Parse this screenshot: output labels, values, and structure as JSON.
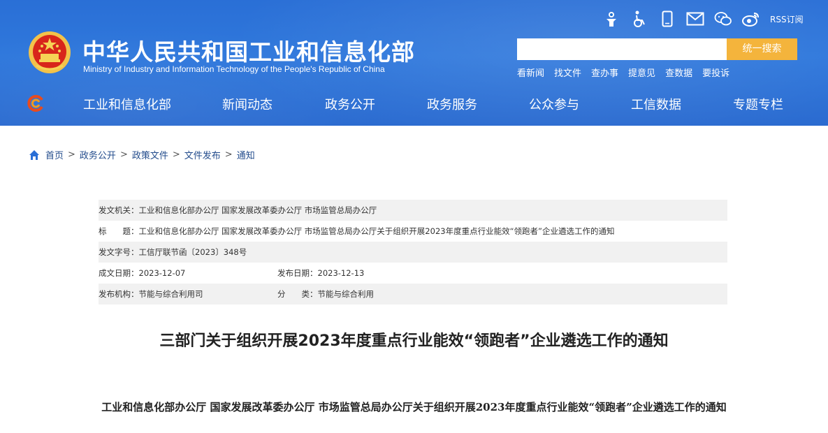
{
  "header": {
    "site_title": "中华人民共和国工业和信息化部",
    "site_subtitle": "Ministry of Industry and Information Technology of the People's Republic of China",
    "rss_label": "RSS订阅",
    "search_button": "统一搜索",
    "search_value": "",
    "quick_links": [
      "看新闻",
      "找文件",
      "查办事",
      "提意见",
      "查数据",
      "要投诉"
    ]
  },
  "nav": {
    "items": [
      "工业和信息化部",
      "新闻动态",
      "政务公开",
      "政务服务",
      "公众参与",
      "工信数据",
      "专题专栏"
    ]
  },
  "breadcrumb": [
    "首页",
    "政务公开",
    "政策文件",
    "文件发布",
    "通知"
  ],
  "doc_info": {
    "issuer_label": "发文机关：",
    "issuer": "工业和信息化部办公厅 国家发展改革委办公厅 市场监管总局办公厅",
    "title_label": "标　　题：",
    "title": "工业和信息化部办公厅 国家发展改革委办公厅 市场监管总局办公厅关于组织开展2023年度重点行业能效“领跑者”企业遴选工作的通知",
    "docno_label": "发文字号：",
    "docno": "工信厅联节函〔2023〕348号",
    "made_label": "成文日期：",
    "made": "2023-12-07",
    "pub_label": "发布日期：",
    "pub": "2023-12-13",
    "org_label": "发布机构：",
    "org": "节能与综合利用司",
    "cat_label": "分　　类：",
    "cat": "节能与综合利用"
  },
  "article": {
    "title": "三部门关于组织开展2023年度重点行业能效“领跑者”企业遴选工作的通知",
    "body_title": "工业和信息化部办公厅  国家发展改革委办公厅  市场监管总局办公厅关于组织开展2023年度重点行业能效“领跑者”企业遴选工作的通知"
  },
  "colors": {
    "header_blue": "#2f78dc",
    "search_orange": "#f4b43c",
    "crumb_blue": "#234c8c",
    "row_gray": "#f1f1f1"
  },
  "icons": [
    "emblem-icon",
    "accessibility-person-icon",
    "wheelchair-icon",
    "mobile-icon",
    "mail-icon",
    "wechat-icon",
    "weibo-icon",
    "nav-logo-icon",
    "home-icon"
  ]
}
